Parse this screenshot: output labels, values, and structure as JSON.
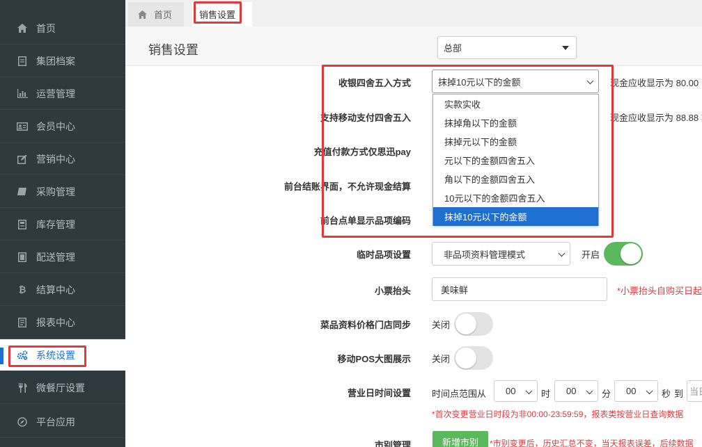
{
  "sidebar": {
    "items": [
      {
        "label": "首页",
        "icon": "home-icon"
      },
      {
        "label": "集团档案",
        "icon": "file-icon"
      },
      {
        "label": "运营管理",
        "icon": "bar-chart-icon"
      },
      {
        "label": "会员中心",
        "icon": "id-card-icon"
      },
      {
        "label": "营销中心",
        "icon": "edit-icon"
      },
      {
        "label": "采购管理",
        "icon": "book-icon"
      },
      {
        "label": "库存管理",
        "icon": "inventory-icon"
      },
      {
        "label": "配送管理",
        "icon": "delivery-icon"
      },
      {
        "label": "结算中心",
        "icon": "bitcoin-icon"
      },
      {
        "label": "报表中心",
        "icon": "report-icon"
      },
      {
        "label": "系统设置",
        "icon": "cogs-icon",
        "active": true
      },
      {
        "label": "微餐厅设置",
        "icon": "cutlery-icon"
      },
      {
        "label": "平台应用",
        "icon": "compass-icon"
      }
    ]
  },
  "tabs": [
    {
      "label": "首页",
      "icon": "home-icon"
    },
    {
      "label": "销售设置",
      "active": true
    }
  ],
  "header": {
    "title": "销售设置",
    "branch_select": "总部"
  },
  "form": {
    "rounding": {
      "label": "收银四舍五入方式",
      "value": "抹掉10元以下的金额",
      "note": "现金应收显示为 80.00"
    },
    "mobile_rounding": {
      "label": "支持移动支付四舍五入",
      "note": "现金应收显示为 88.88"
    },
    "recharge_pay": {
      "label": "充值付款方式仅思迅pay"
    },
    "no_cash": {
      "label": "前台结账界面，不允许现金结算"
    },
    "show_code": {
      "label": "前台点单显示品项编码"
    },
    "temp_item": {
      "label": "临时品项设置",
      "value": "非品项资料管理模式",
      "switch_label": "开启"
    },
    "receipt_header": {
      "label": "小票抬头",
      "value": "美味鲜",
      "note": "*小票抬头自购买日起"
    },
    "price_sync": {
      "label": "菜品资料价格门店同步",
      "switch_label": "关闭"
    },
    "pos_image": {
      "label": "移动POS大图展示",
      "switch_label": "关闭"
    },
    "business_time": {
      "label": "营业日时间设置",
      "prefix": "时间点范围从",
      "hour": "00",
      "hour_unit": "时",
      "minute": "00",
      "minute_unit": "分",
      "second": "00",
      "second_unit": "秒",
      "to": "到",
      "end_value": "当日",
      "note": "*首次变更营业日时段为非00:00-23:59:59，报表类按营业日查询数据"
    },
    "market": {
      "label": "市别管理",
      "button": "新增市别",
      "note": "*市别变更后，历史汇总不变，当天报表误差，后续数据"
    }
  },
  "dropdown_options": [
    "实款实收",
    "抹掉角以下的金额",
    "抹掉元以下的金额",
    "元以下的金额四舍五入",
    "角以下的金额四舍五入",
    "10元以下的金额四舍五入",
    "抹掉10元以下的金额"
  ],
  "dropdown_selected": "抹掉10元以下的金额",
  "colors": {
    "accent": "#1f6fd1",
    "highlight": "#e0393e",
    "switch_on": "#5cb85c"
  }
}
